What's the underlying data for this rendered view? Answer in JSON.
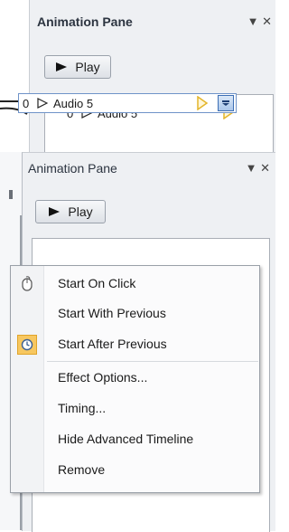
{
  "pane_back": {
    "title": "Animation Pane",
    "controls": "▼ ✕",
    "play_label": "Play",
    "item": {
      "index": "0",
      "label": "Audio 5"
    }
  },
  "pane_front": {
    "title": "Animation Pane",
    "controls": "▼ ✕",
    "play_label": "Play",
    "item": {
      "index": "0",
      "label": "Audio 5"
    }
  },
  "menu": {
    "items": [
      {
        "label": "Start On Click",
        "icon": "mouse-icon"
      },
      {
        "label": "Start With Previous",
        "icon": ""
      },
      {
        "label": "Start After Previous",
        "icon": "clock-icon",
        "selected": true
      },
      {
        "label": "Effect Options...",
        "icon": ""
      },
      {
        "label": "Timing...",
        "icon": ""
      },
      {
        "label": "Hide Advanced Timeline",
        "icon": ""
      },
      {
        "label": "Remove",
        "icon": ""
      }
    ]
  },
  "colors": {
    "pane_bg": "#eef0f3",
    "selected_border": "#6f93c8",
    "clock_highlight": "#f7c760",
    "trigger_gold": "#e3b52b"
  }
}
